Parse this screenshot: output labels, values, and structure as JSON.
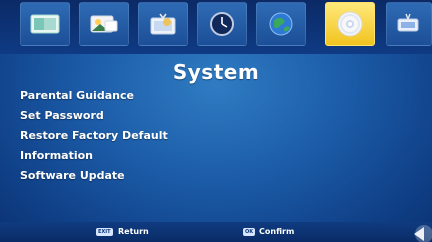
{
  "header": {
    "tabs": [
      {
        "icon": "picture-icon",
        "active": false
      },
      {
        "icon": "photo-icon",
        "active": false
      },
      {
        "icon": "tv-icon",
        "active": false
      },
      {
        "icon": "clock-icon",
        "active": false
      },
      {
        "icon": "globe-icon",
        "active": false
      },
      {
        "icon": "disc-icon",
        "active": true
      },
      {
        "icon": "channel-icon",
        "active": false
      }
    ]
  },
  "main": {
    "title": "System",
    "items": [
      {
        "label": "Parental Guidance"
      },
      {
        "label": "Set Password"
      },
      {
        "label": "Restore Factory Default"
      },
      {
        "label": "Information"
      },
      {
        "label": "Software Update"
      }
    ]
  },
  "footer": {
    "return_key": "EXIT",
    "return_label": "Return",
    "confirm_key": "OK",
    "confirm_label": "Confirm"
  },
  "colors": {
    "background": "#1b5aa6",
    "active_tab": "#f1c31f",
    "text": "#ffffff"
  }
}
